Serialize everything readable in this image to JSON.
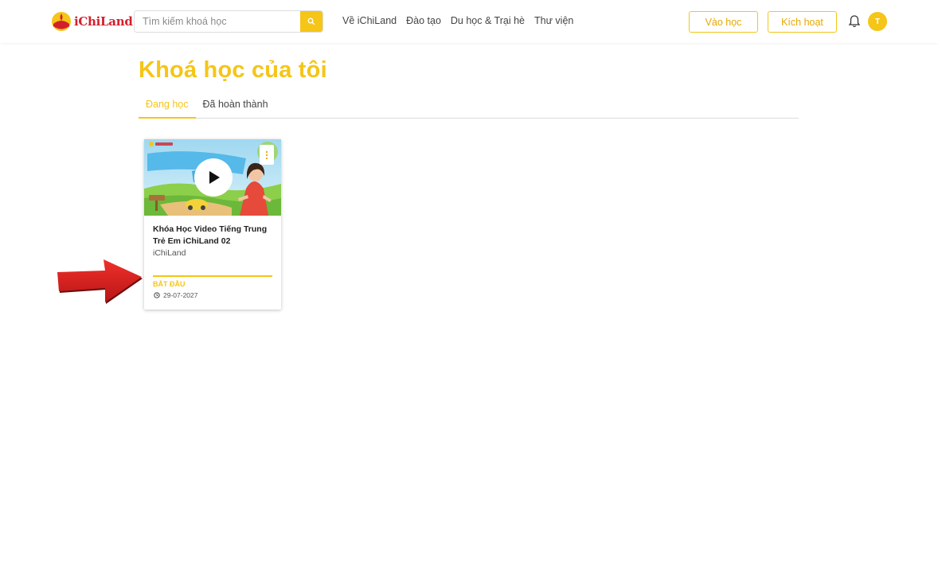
{
  "header": {
    "logo_text": "iChiLand",
    "search": {
      "placeholder": "Tìm kiếm khoá học"
    },
    "nav": [
      "Về iChiLand",
      "Đào tạo",
      "Du học & Trại hè",
      "Thư viện"
    ],
    "learn_button": "Vào học",
    "activate_button": "Kích hoạt",
    "avatar_letter": "T"
  },
  "main": {
    "title": "Khoá học của tôi",
    "tabs": [
      {
        "label": "Đang học",
        "active": true
      },
      {
        "label": "Đã hoàn thành",
        "active": false
      }
    ],
    "courses": [
      {
        "title": "Khóa Học Video Tiếng Trung Trẻ Em iChiLand 02",
        "author": "iChiLand",
        "action": "BẮT ĐẦU",
        "date": "29-07-2027",
        "progress": 1.0
      }
    ]
  },
  "colors": {
    "accent": "#f5c518",
    "brand_red": "#d4202c",
    "annotation_arrow": "#e0201f"
  }
}
